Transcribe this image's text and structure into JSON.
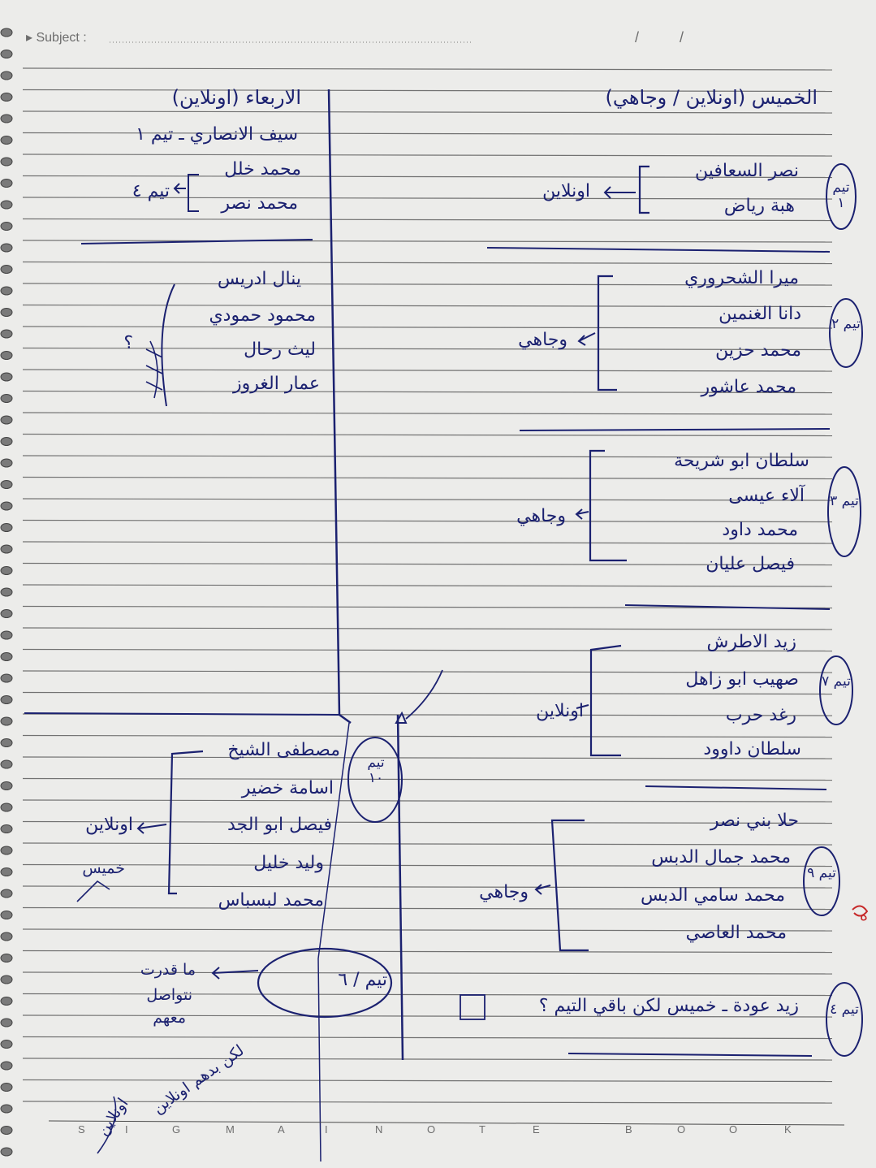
{
  "notebook": {
    "subject_label": "▸ Subject :",
    "date_slashes": "/          /",
    "footer_letters": [
      "S",
      "I",
      "G",
      "M",
      "A",
      "I",
      "N",
      "O",
      "T",
      "E",
      "B",
      "O",
      "O",
      "K"
    ]
  },
  "right_column": {
    "header": "الخميس (اونلاين / وجاهي)",
    "teams": [
      {
        "badge": "تيم ١",
        "members": [
          "نصر السعافين",
          "هبة رياض"
        ],
        "mode": "اونلاين"
      },
      {
        "badge": "تيم ٢",
        "members": [
          "ميرا الشحروري",
          "دانا الغنمين",
          "محمد حزين",
          "محمد عاشور"
        ],
        "mode": "وجاهي"
      },
      {
        "badge": "تيم ٣",
        "members": [
          "سلطان ابو شريحة",
          "آلاء عيسى",
          "محمد داود",
          "فيصل عليان"
        ],
        "mode": "وجاهي"
      },
      {
        "badge": "تيم ٧",
        "members": [
          "زيد الاطرش",
          "صهيب ابو زاهل",
          "رغد حرب",
          "سلطان داوود"
        ],
        "mode": "اونلاين"
      },
      {
        "badge": "تيم ٩",
        "members": [
          "حلا بني نصر",
          "محمد جمال الدبس",
          "محمد سامي الدبس",
          "محمد العاصي"
        ],
        "mode": "وجاهي"
      }
    ],
    "team4_badge": "تيم ٤",
    "team4_note": "زيد عودة ـ خميس لكن باقي التيم ؟",
    "margin_mark": "ه"
  },
  "left_column": {
    "header": "الاربعاء (اونلاين)",
    "line1": "سيف الانصاري ـ تيم ١",
    "team4_members": [
      "محمد خلل",
      "محمد نصر"
    ],
    "team4_label": "تيم ٤",
    "group_members": [
      "ينال ادريس",
      "محمود حمودي",
      "ليث رحال",
      "عمار الغروز"
    ],
    "group_mark": "؟",
    "team10": {
      "badge": "تيم ١٠",
      "members": [
        "مصطفى الشيخ",
        "اسامة خضير",
        "فيصل ابو الجد",
        "وليد خليل",
        "محمد لبسباس"
      ],
      "mode": "اونلاين",
      "note": "خميس"
    },
    "team6": {
      "badge": "تيم / ٦",
      "note_lines": [
        "ما قدرت",
        "نتواصل",
        "معهم",
        "لكن بدهم اونلاين"
      ]
    },
    "signature": "اونلاين"
  }
}
